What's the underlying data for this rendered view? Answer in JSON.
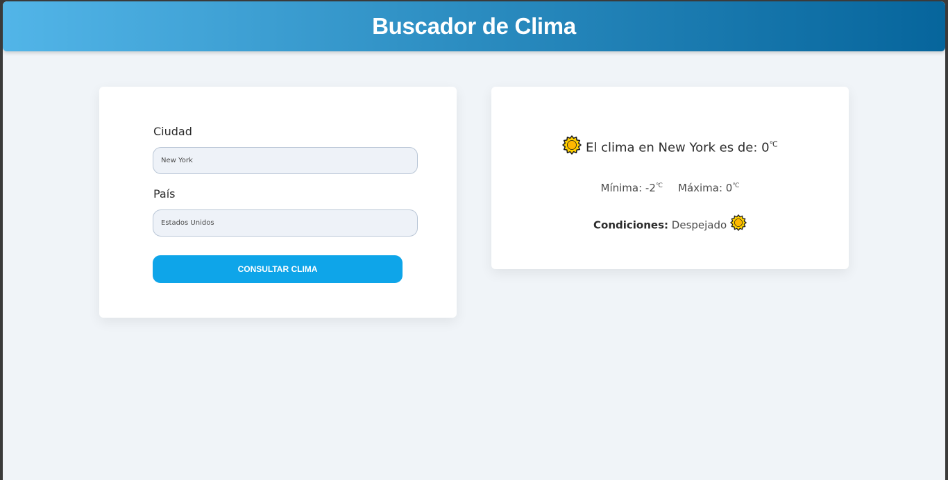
{
  "header": {
    "title": "Buscador de Clima"
  },
  "form": {
    "city_label": "Ciudad",
    "city_value": "New York",
    "country_label": "País",
    "country_value": "Estados Unidos",
    "submit_label": "CONSULTAR CLIMA"
  },
  "result": {
    "temp_prefix": "El clima en New York es de: 0",
    "unit": "℃",
    "min_text": "Mínima: -2",
    "max_text": "Máxima: 0",
    "conditions_label": "Condiciones:",
    "conditions_value": "Despejado",
    "icon": "sun-icon"
  },
  "colors": {
    "header_start": "#52b5e8",
    "header_end": "#06659c",
    "button": "#0ea5e9",
    "page_bg": "#f0f4f8",
    "sun": "#ffd000"
  }
}
